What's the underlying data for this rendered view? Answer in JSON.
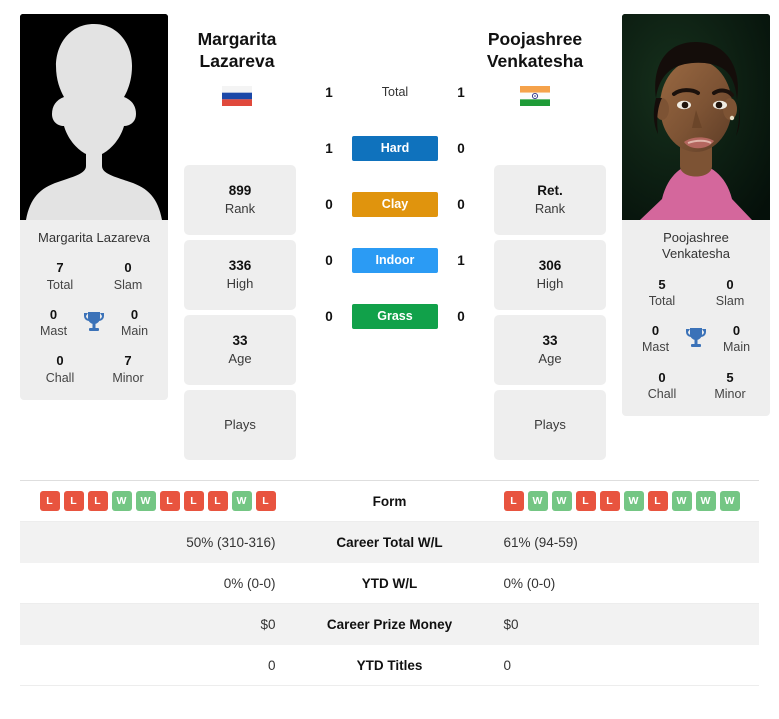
{
  "players": {
    "left": {
      "name_line1": "Margarita",
      "name_line2": "Lazareva",
      "full_name": "Margarita Lazareva",
      "country": "Russia",
      "flag_icon": "flag-russia",
      "photo_type": "silhouette-placeholder",
      "titles": [
        {
          "value": "7",
          "label": "Total"
        },
        {
          "value": "0",
          "label": "Slam"
        },
        {
          "value": "0",
          "label": "Mast"
        },
        {
          "value": "0",
          "label": "Main"
        },
        {
          "value": "0",
          "label": "Chall"
        },
        {
          "value": "7",
          "label": "Minor"
        }
      ],
      "cards": [
        {
          "value": "899",
          "label": "Rank"
        },
        {
          "value": "336",
          "label": "High"
        },
        {
          "value": "33",
          "label": "Age"
        },
        {
          "value": "",
          "label": "Plays"
        }
      ]
    },
    "right": {
      "name_line1": "Poojashree",
      "name_line2": "Venkatesha",
      "full_name_line1": "Poojashree",
      "full_name_line2": "Venkatesha",
      "country": "India",
      "flag_icon": "flag-india",
      "photo_type": "player-photo",
      "titles": [
        {
          "value": "5",
          "label": "Total"
        },
        {
          "value": "0",
          "label": "Slam"
        },
        {
          "value": "0",
          "label": "Mast"
        },
        {
          "value": "0",
          "label": "Main"
        },
        {
          "value": "0",
          "label": "Chall"
        },
        {
          "value": "5",
          "label": "Minor"
        }
      ],
      "cards": [
        {
          "value": "Ret.",
          "label": "Rank"
        },
        {
          "value": "306",
          "label": "High"
        },
        {
          "value": "33",
          "label": "Age"
        },
        {
          "value": "",
          "label": "Plays"
        }
      ]
    }
  },
  "surfaces": [
    {
      "label": "Total",
      "left": "1",
      "right": "1",
      "color": "transparent",
      "style": "plain"
    },
    {
      "label": "Hard",
      "left": "1",
      "right": "0",
      "color": "#0f72bd",
      "style": "pill"
    },
    {
      "label": "Clay",
      "left": "0",
      "right": "0",
      "color": "#e0940d",
      "style": "pill"
    },
    {
      "label": "Indoor",
      "left": "0",
      "right": "1",
      "color": "#2b9bf4",
      "style": "pill"
    },
    {
      "label": "Grass",
      "left": "0",
      "right": "0",
      "color": "#11a14a",
      "style": "pill"
    }
  ],
  "comparison_rows": [
    {
      "label": "Form",
      "type": "form",
      "left_form": [
        "L",
        "L",
        "L",
        "W",
        "W",
        "L",
        "L",
        "L",
        "W",
        "L"
      ],
      "right_form": [
        "L",
        "W",
        "W",
        "L",
        "L",
        "W",
        "L",
        "W",
        "W",
        "W"
      ]
    },
    {
      "label": "Career Total W/L",
      "type": "text",
      "left": "50% (310-316)",
      "right": "61% (94-59)"
    },
    {
      "label": "YTD W/L",
      "type": "text",
      "left": "0% (0-0)",
      "right": "0% (0-0)"
    },
    {
      "label": "Career Prize Money",
      "type": "text",
      "left": "$0",
      "right": "$0"
    },
    {
      "label": "YTD Titles",
      "type": "text",
      "left": "0",
      "right": "0"
    }
  ],
  "colors": {
    "win": "#74c684",
    "loss": "#e8543f",
    "card_bg": "#eeeeee",
    "row_stripe": "#f2f2f2",
    "trophy": "#3b72b8"
  }
}
